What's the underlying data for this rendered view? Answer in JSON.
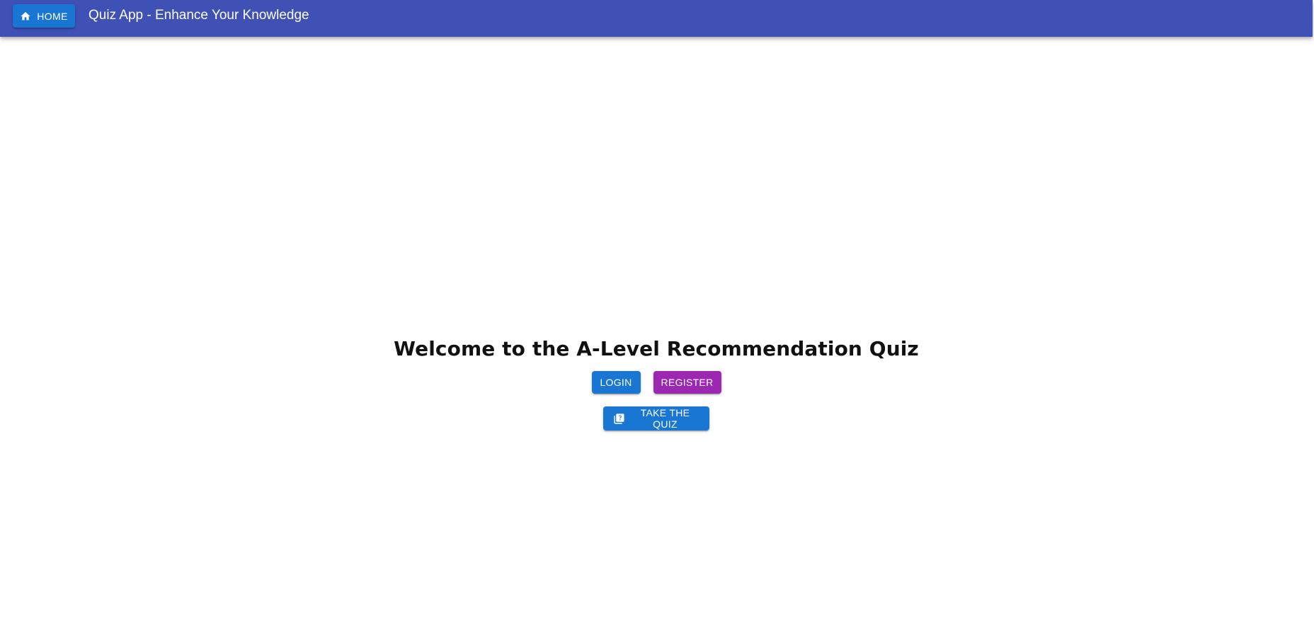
{
  "header": {
    "home_label": "HOME",
    "title": "Quiz App - Enhance Your Knowledge",
    "background_color": "#3f51b5"
  },
  "main": {
    "heading": "Welcome to the A-Level Recommendation Quiz",
    "login_label": "LOGIN",
    "register_label": "REGISTER",
    "take_quiz_label": "TAKE THE QUIZ"
  },
  "icons": {
    "home": "home-icon",
    "quiz": "quiz-icon"
  },
  "colors": {
    "primary": "#1976d2",
    "secondary": "#9c27b0"
  }
}
